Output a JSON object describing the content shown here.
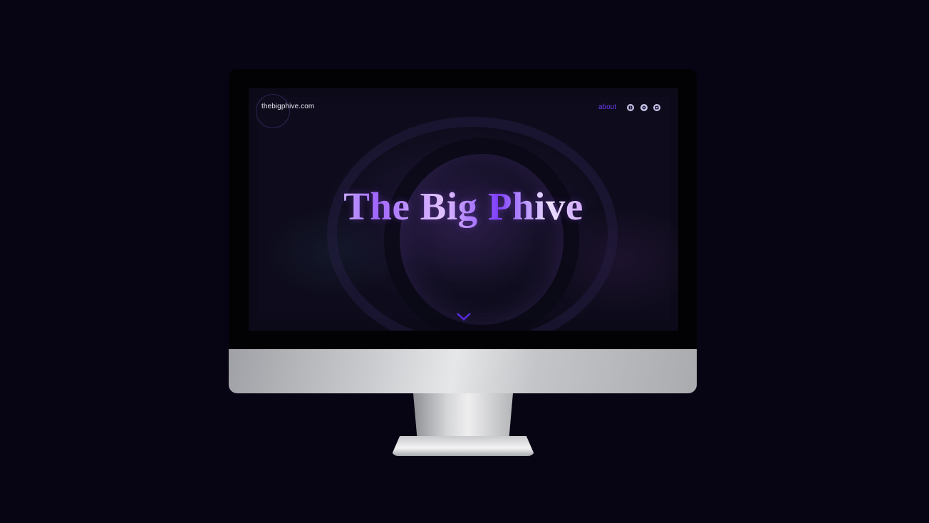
{
  "site": {
    "logo_text": "thebigphive.com",
    "nav": {
      "about_label": "about"
    },
    "social_icons": [
      "facebook-icon",
      "dribbble-icon",
      "instagram-icon"
    ],
    "hero": {
      "title": "The Big Phive"
    },
    "scroll_icon": "chevron-down-icon"
  },
  "colors": {
    "page_background": "#070413",
    "accent": "#6c3cf0",
    "social_icon_fill": "#c9c5e8"
  }
}
